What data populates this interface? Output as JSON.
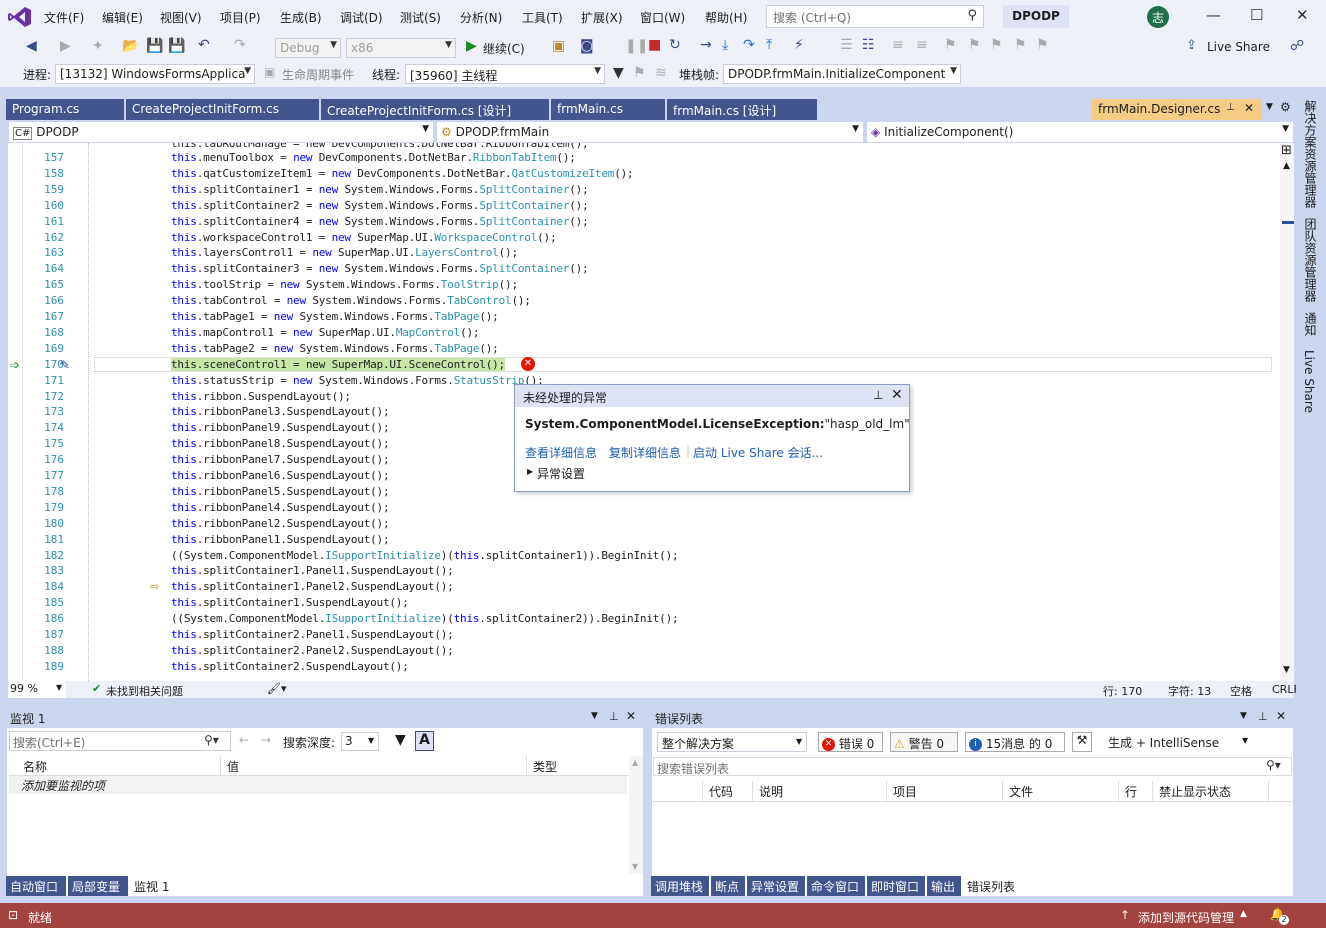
{
  "colors": {
    "accent": "#40568d",
    "active_tab": "#f5cc84",
    "status_bar": "#a3433e",
    "error": "#e51400",
    "warning": "#ffcc00"
  },
  "menu": [
    "文件(F)",
    "编辑(E)",
    "视图(V)",
    "项目(P)",
    "生成(B)",
    "调试(D)",
    "测试(S)",
    "分析(N)",
    "工具(T)",
    "扩展(X)",
    "窗口(W)",
    "帮助(H)"
  ],
  "search": {
    "placeholder": "搜索 (Ctrl+Q)"
  },
  "project_badge": "DPODP",
  "avatar": "志",
  "toolbar": {
    "config": "Debug",
    "platform": "x86",
    "continue": "继续(C)",
    "live_share": "Live Share"
  },
  "debug": {
    "process_label": "进程:",
    "process_value": "[13132] WindowsFormsApplica",
    "lifecycle": "生命周期事件",
    "thread_label": "线程:",
    "thread_value": "[35960] 主线程",
    "stack_label": "堆栈帧:",
    "stack_value": "DPODP.frmMain.InitializeComponent"
  },
  "tabs": [
    "Program.cs",
    "CreateProjectInitForm.cs",
    "CreateProjectInitForm.cs [设计]",
    "frmMain.cs",
    "frmMain.cs [设计]"
  ],
  "active_tab": "frmMain.Designer.cs",
  "nav": {
    "project": "DPODP",
    "class": "DPODP.frmMain",
    "method": "InitializeComponent()"
  },
  "code": {
    "first_line_partial": "this.tabRoutManage = new DevComponents.DotNetBar.RibbonTabItem();",
    "lines": [
      {
        "n": "157",
        "parts": [
          [
            "kw",
            "this"
          ],
          [
            "",
            "."
          ],
          [
            "",
            "menuToolbox = "
          ],
          [
            "kw",
            "new"
          ],
          [
            "",
            " DevComponents.DotNetBar."
          ],
          [
            "ty",
            "RibbonTabItem"
          ],
          [
            "",
            "();"
          ]
        ]
      },
      {
        "n": "158",
        "parts": [
          [
            "kw",
            "this"
          ],
          [
            "",
            ".qatCustomizeItem1 = "
          ],
          [
            "kw",
            "new"
          ],
          [
            "",
            " DevComponents.DotNetBar."
          ],
          [
            "ty",
            "QatCustomizeItem"
          ],
          [
            "",
            "();"
          ]
        ]
      },
      {
        "n": "159",
        "parts": [
          [
            "kw",
            "this"
          ],
          [
            "",
            ".splitContainer1 = "
          ],
          [
            "kw",
            "new"
          ],
          [
            "",
            " System.Windows.Forms."
          ],
          [
            "ty",
            "SplitContainer"
          ],
          [
            "",
            "();"
          ]
        ]
      },
      {
        "n": "160",
        "parts": [
          [
            "kw",
            "this"
          ],
          [
            "",
            ".splitContainer2 = "
          ],
          [
            "kw",
            "new"
          ],
          [
            "",
            " System.Windows.Forms."
          ],
          [
            "ty",
            "SplitContainer"
          ],
          [
            "",
            "();"
          ]
        ]
      },
      {
        "n": "161",
        "parts": [
          [
            "kw",
            "this"
          ],
          [
            "",
            ".splitContainer4 = "
          ],
          [
            "kw",
            "new"
          ],
          [
            "",
            " System.Windows.Forms."
          ],
          [
            "ty",
            "SplitContainer"
          ],
          [
            "",
            "();"
          ]
        ]
      },
      {
        "n": "162",
        "parts": [
          [
            "kw",
            "this"
          ],
          [
            "",
            ".workspaceControl1 = "
          ],
          [
            "kw",
            "new"
          ],
          [
            "",
            " SuperMap.UI."
          ],
          [
            "ty",
            "WorkspaceControl"
          ],
          [
            "",
            "();"
          ]
        ]
      },
      {
        "n": "163",
        "parts": [
          [
            "kw",
            "this"
          ],
          [
            "",
            ".layersControl1 = "
          ],
          [
            "kw",
            "new"
          ],
          [
            "",
            " SuperMap.UI."
          ],
          [
            "ty",
            "LayersControl"
          ],
          [
            "",
            "();"
          ]
        ]
      },
      {
        "n": "164",
        "parts": [
          [
            "kw",
            "this"
          ],
          [
            "",
            ".splitContainer3 = "
          ],
          [
            "kw",
            "new"
          ],
          [
            "",
            " System.Windows.Forms."
          ],
          [
            "ty",
            "SplitContainer"
          ],
          [
            "",
            "();"
          ]
        ]
      },
      {
        "n": "165",
        "parts": [
          [
            "kw",
            "this"
          ],
          [
            "",
            ".toolStrip = "
          ],
          [
            "kw",
            "new"
          ],
          [
            "",
            " System.Windows.Forms."
          ],
          [
            "ty",
            "ToolStrip"
          ],
          [
            "",
            "();"
          ]
        ]
      },
      {
        "n": "166",
        "parts": [
          [
            "kw",
            "this"
          ],
          [
            "",
            ".tabControl = "
          ],
          [
            "kw",
            "new"
          ],
          [
            "",
            " System.Windows.Forms."
          ],
          [
            "ty",
            "TabControl"
          ],
          [
            "",
            "();"
          ]
        ]
      },
      {
        "n": "167",
        "parts": [
          [
            "kw",
            "this"
          ],
          [
            "",
            ".tabPage1 = "
          ],
          [
            "kw",
            "new"
          ],
          [
            "",
            " System.Windows.Forms."
          ],
          [
            "ty",
            "TabPage"
          ],
          [
            "",
            "();"
          ]
        ]
      },
      {
        "n": "168",
        "parts": [
          [
            "kw",
            "this"
          ],
          [
            "",
            ".mapControl1 = "
          ],
          [
            "kw",
            "new"
          ],
          [
            "",
            " SuperMap.UI."
          ],
          [
            "ty",
            "MapControl"
          ],
          [
            "",
            "();"
          ]
        ]
      },
      {
        "n": "169",
        "parts": [
          [
            "kw",
            "this"
          ],
          [
            "",
            ".tabPage2 = "
          ],
          [
            "kw",
            "new"
          ],
          [
            "",
            " System.Windows.Forms."
          ],
          [
            "ty",
            "TabPage"
          ],
          [
            "",
            "();"
          ]
        ]
      },
      {
        "n": "170",
        "hl": true,
        "parts": [
          [
            "",
            "this.sceneControl1 = new SuperMap.UI.SceneControl();"
          ]
        ]
      },
      {
        "n": "171",
        "parts": [
          [
            "kw",
            "this"
          ],
          [
            "",
            ".statusStrip = "
          ],
          [
            "kw",
            "new"
          ],
          [
            "",
            " System.Windows.Forms."
          ],
          [
            "ty",
            "StatusStrip"
          ],
          [
            "",
            "();"
          ]
        ]
      },
      {
        "n": "172",
        "parts": [
          [
            "kw",
            "this"
          ],
          [
            "",
            ".ribbon.SuspendLayout();"
          ]
        ]
      },
      {
        "n": "173",
        "parts": [
          [
            "kw",
            "this"
          ],
          [
            "",
            ".ribbonPanel3.SuspendLayout();"
          ]
        ]
      },
      {
        "n": "174",
        "parts": [
          [
            "kw",
            "this"
          ],
          [
            "",
            ".ribbonPanel9.SuspendLayout();"
          ]
        ]
      },
      {
        "n": "175",
        "parts": [
          [
            "kw",
            "this"
          ],
          [
            "",
            ".ribbonPanel8.SuspendLayout();"
          ]
        ]
      },
      {
        "n": "176",
        "parts": [
          [
            "kw",
            "this"
          ],
          [
            "",
            ".ribbonPanel7.SuspendLayout();"
          ]
        ]
      },
      {
        "n": "177",
        "parts": [
          [
            "kw",
            "this"
          ],
          [
            "",
            ".ribbonPanel6.SuspendLayout();"
          ]
        ]
      },
      {
        "n": "178",
        "parts": [
          [
            "kw",
            "this"
          ],
          [
            "",
            ".ribbonPanel5.SuspendLayout();"
          ]
        ]
      },
      {
        "n": "179",
        "parts": [
          [
            "kw",
            "this"
          ],
          [
            "",
            ".ribbonPanel4.SuspendLayout();"
          ]
        ]
      },
      {
        "n": "180",
        "parts": [
          [
            "kw",
            "this"
          ],
          [
            "",
            ".ribbonPanel2.SuspendLayout();"
          ]
        ]
      },
      {
        "n": "181",
        "parts": [
          [
            "kw",
            "this"
          ],
          [
            "",
            ".ribbonPanel1.SuspendLayout();"
          ]
        ]
      },
      {
        "n": "182",
        "parts": [
          [
            "",
            "((System.ComponentModel."
          ],
          [
            "ty",
            "ISupportInitialize"
          ],
          [
            "",
            ")("
          ],
          [
            "kw",
            "this"
          ],
          [
            "",
            ".splitContainer1)).BeginInit();"
          ]
        ]
      },
      {
        "n": "183",
        "parts": [
          [
            "kw",
            "this"
          ],
          [
            "",
            ".splitContainer1.Panel1.SuspendLayout();"
          ]
        ]
      },
      {
        "n": "184",
        "parts": [
          [
            "kw",
            "this"
          ],
          [
            "",
            ".splitContainer1.Panel2.SuspendLayout();"
          ]
        ]
      },
      {
        "n": "185",
        "parts": [
          [
            "kw",
            "this"
          ],
          [
            "",
            ".splitContainer1.SuspendLayout();"
          ]
        ]
      },
      {
        "n": "186",
        "parts": [
          [
            "",
            "((System.ComponentModel."
          ],
          [
            "ty",
            "ISupportInitialize"
          ],
          [
            "",
            ")("
          ],
          [
            "kw",
            "this"
          ],
          [
            "",
            ".splitContainer2)).BeginInit();"
          ]
        ]
      },
      {
        "n": "187",
        "parts": [
          [
            "kw",
            "this"
          ],
          [
            "",
            ".splitContainer2.Panel1.SuspendLayout();"
          ]
        ]
      },
      {
        "n": "188",
        "parts": [
          [
            "kw",
            "this"
          ],
          [
            "",
            ".splitContainer2.Panel2.SuspendLayout();"
          ]
        ]
      },
      {
        "n": "189",
        "parts": [
          [
            "kw",
            "this"
          ],
          [
            "",
            ".splitContainer2.SuspendLayout();"
          ]
        ]
      }
    ]
  },
  "exception": {
    "title": "未经处理的异常",
    "message_type": "System.ComponentModel.LicenseException:",
    "message_text": "\"hasp_old_lm\"",
    "link_details": "查看详细信息",
    "link_copy": "复制详细信息",
    "link_liveshare": "启动 Live Share 会话...",
    "settings": "异常设置"
  },
  "editor_status": {
    "zoom": "99 %",
    "issues": "未找到相关问题",
    "line": "行: 170",
    "col": "字符: 13",
    "ws": "空格",
    "eol": "CRLF"
  },
  "watch": {
    "title": "监视 1",
    "search_placeholder": "搜索(Ctrl+E)",
    "depth_label": "搜索深度:",
    "depth_value": "3",
    "col_name": "名称",
    "col_value": "值",
    "col_type": "类型",
    "add_item": "添加要监视的项",
    "tabs": [
      "自动窗口",
      "局部变量",
      "监视 1"
    ]
  },
  "errors": {
    "title": "错误列表",
    "scope": "整个解决方案",
    "errors_btn": "错误 0",
    "warnings_btn": "警告 0",
    "messages_btn": "15消息 的 0",
    "build_filter": "生成 + IntelliSense",
    "search_placeholder": "搜索错误列表",
    "cols": [
      "代码",
      "说明",
      "项目",
      "文件",
      "行",
      "禁止显示状态"
    ],
    "tabs": [
      "调用堆栈",
      "断点",
      "异常设置",
      "命令窗口",
      "即时窗口",
      "输出",
      "错误列表"
    ]
  },
  "status": {
    "ready": "就绪",
    "source_control": "添加到源代码管理",
    "notif": "2"
  },
  "right_panels": [
    "解决方案资源管理器",
    "团队资源管理器",
    "通知",
    "Live Share"
  ]
}
